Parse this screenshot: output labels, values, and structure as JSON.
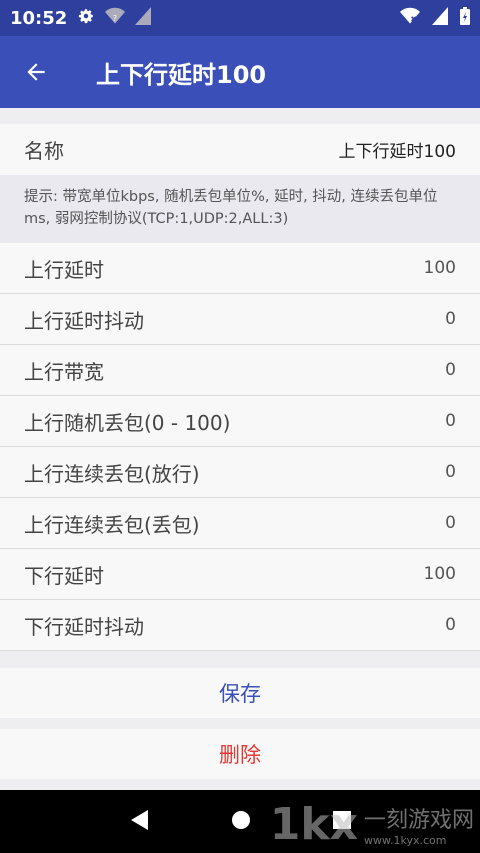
{
  "status": {
    "time": "10:52"
  },
  "appbar": {
    "title": "上下行延时100"
  },
  "name_row": {
    "label": "名称",
    "value": "上下行延时100"
  },
  "hint": "提示: 带宽单位kbps, 随机丢包单位%, 延时, 抖动, 连续丢包单位ms, 弱网控制协议(TCP:1,UDP:2,ALL:3)",
  "params": [
    {
      "label": "上行延时",
      "value": "100"
    },
    {
      "label": "上行延时抖动",
      "value": "0"
    },
    {
      "label": "上行带宽",
      "value": "0"
    },
    {
      "label": "上行随机丢包(0 - 100)",
      "value": "0"
    },
    {
      "label": "上行连续丢包(放行)",
      "value": "0"
    },
    {
      "label": "上行连续丢包(丢包)",
      "value": "0"
    },
    {
      "label": "下行延时",
      "value": "100"
    },
    {
      "label": "下行延时抖动",
      "value": "0"
    }
  ],
  "buttons": {
    "save": "保存",
    "delete": "删除"
  },
  "watermark": {
    "logo": "1kx",
    "name": "一刻游戏网",
    "url": "www.1kyx.com"
  },
  "icons": {
    "status_left": [
      "gear-icon",
      "wifi-question-icon",
      "signal-icon"
    ],
    "status_right": [
      "wifi-x-icon",
      "signal-full-icon",
      "battery-icon"
    ],
    "navigation": [
      "back-triangle-icon",
      "home-circle-icon",
      "recents-square-icon"
    ]
  },
  "colors": {
    "status_bar": "#2e3f9d",
    "app_bar": "#3a4fb8",
    "save": "#3a4fb8",
    "delete": "#e53935"
  }
}
